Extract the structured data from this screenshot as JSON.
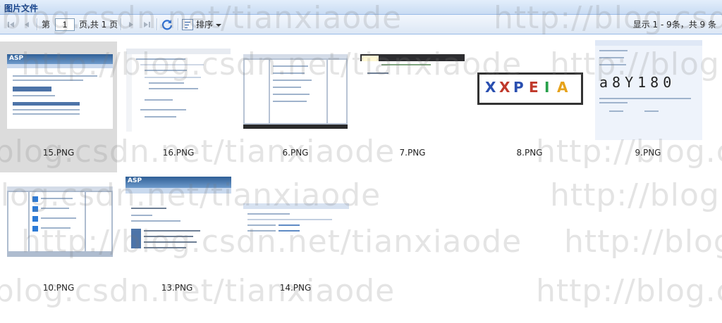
{
  "window": {
    "title": "图片文件"
  },
  "toolbar": {
    "page_prefix": "第",
    "page_value": "1",
    "page_suffix": "页,共 1 页",
    "sort_label": "排序",
    "status": "显示 1 - 9条，共 9 条"
  },
  "icons": {
    "first": "first-page-icon",
    "prev": "prev-page-icon",
    "next": "next-page-icon",
    "last": "last-page-icon",
    "refresh": "refresh-icon",
    "sort": "sort-icon",
    "dropdown": "chevron-down-icon"
  },
  "files": [
    {
      "name": "15.PNG",
      "selected": true
    },
    {
      "name": "16.PNG",
      "selected": false
    },
    {
      "name": "6.PNG",
      "selected": false
    },
    {
      "name": "7.PNG",
      "selected": false
    },
    {
      "name": "8.PNG",
      "selected": false
    },
    {
      "name": "9.PNG",
      "selected": false
    },
    {
      "name": "10.PNG",
      "selected": false
    },
    {
      "name": "13.PNG",
      "selected": false
    },
    {
      "name": "14.PNG",
      "selected": false
    }
  ],
  "thumbnails": {
    "asp_logo": "ASP",
    "captcha_text": "XXPEIA",
    "login_captcha": "a8Y180"
  },
  "watermark": {
    "text": "http://blog.csdn.net/tianxiaode"
  },
  "colors": {
    "title": "#15428b",
    "border": "#99bbe8",
    "selected_bg": "#dcdcdc"
  }
}
